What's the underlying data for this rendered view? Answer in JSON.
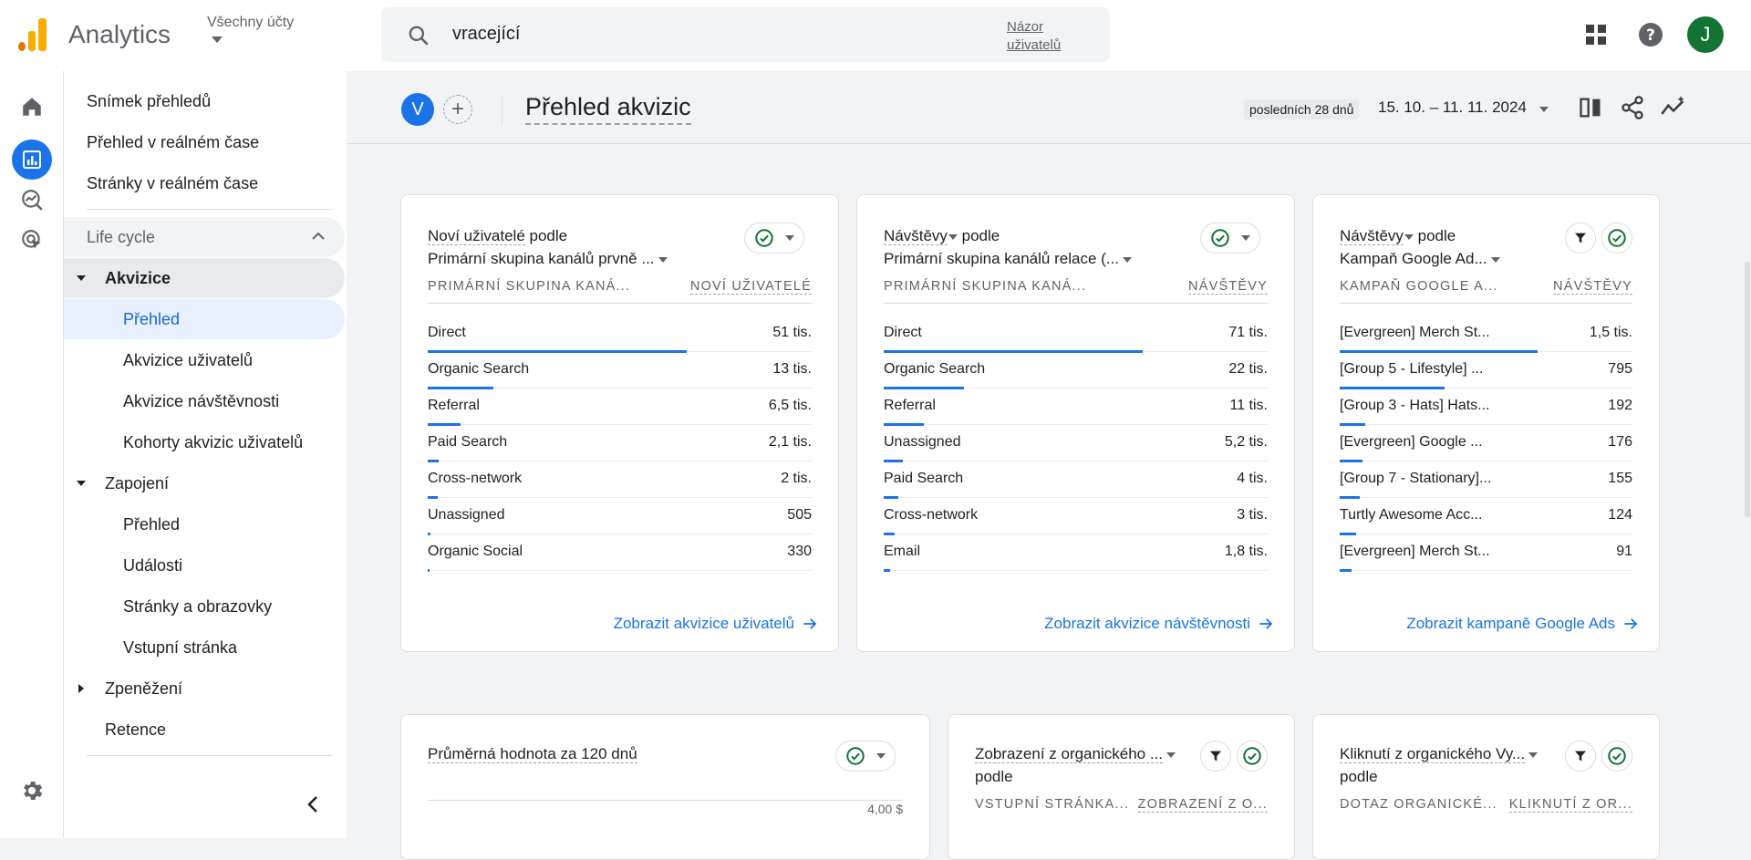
{
  "topbar": {
    "app_title": "Analytics",
    "account_label": "Všechny účty",
    "search_value": "vracející",
    "search_link": "Názor uživatelů",
    "avatar_letter": "J"
  },
  "rail": {
    "icons": [
      "home-icon",
      "reports-icon",
      "explore-icon",
      "advertising-icon",
      "settings-icon"
    ]
  },
  "sidebar": {
    "items": [
      {
        "label": "Snímek přehledů"
      },
      {
        "label": "Přehled v reálném čase"
      },
      {
        "label": "Stránky v reálném čase"
      },
      {
        "label": "Life cycle"
      },
      {
        "label": "Akvizice"
      },
      {
        "label": "Přehled"
      },
      {
        "label": "Akvizice uživatelů"
      },
      {
        "label": "Akvizice návštěvnosti"
      },
      {
        "label": "Kohorty akvizic uživatelů"
      },
      {
        "label": "Zapojení"
      },
      {
        "label": "Přehled"
      },
      {
        "label": "Události"
      },
      {
        "label": "Stránky a obrazovky"
      },
      {
        "label": "Vstupní stránka"
      },
      {
        "label": "Zpeněžení"
      },
      {
        "label": "Retence"
      }
    ]
  },
  "header": {
    "badge": "V",
    "add": "+",
    "title": "Přehled akvizic",
    "date_chip": "posledních 28 dnů",
    "date_range": "15. 10. – 11. 11. 2024"
  },
  "cards": [
    {
      "title_line1": "Noví uživatelé",
      "title_podle": " podle",
      "title_line2": "Primární skupina kanálů prvně ...",
      "col_left": "PRIMÁRNÍ SKUPINA KANÁ...",
      "col_right": "NOVÍ UŽIVATELÉ",
      "rows": [
        {
          "label": "Direct",
          "value": "51 tis.",
          "share": 1.0
        },
        {
          "label": "Organic Search",
          "value": "13 tis.",
          "share": 0.255
        },
        {
          "label": "Referral",
          "value": "6,5 tis.",
          "share": 0.127
        },
        {
          "label": "Paid Search",
          "value": "2,1 tis.",
          "share": 0.041
        },
        {
          "label": "Cross-network",
          "value": "2 tis.",
          "share": 0.039
        },
        {
          "label": "Unassigned",
          "value": "505",
          "share": 0.01
        },
        {
          "label": "Organic Social",
          "value": "330",
          "share": 0.006
        }
      ],
      "link": "Zobrazit akvizice uživatelů"
    },
    {
      "title_line1": "Návštěvy",
      "title_podle": " podle",
      "title_line2": "Primární skupina kanálů relace (...",
      "col_left": "PRIMÁRNÍ SKUPINA KANÁ...",
      "col_right": "NÁVŠTĚVY",
      "rows": [
        {
          "label": "Direct",
          "value": "71 tis.",
          "share": 1.0
        },
        {
          "label": "Organic Search",
          "value": "22 tis.",
          "share": 0.31
        },
        {
          "label": "Referral",
          "value": "11 tis.",
          "share": 0.155
        },
        {
          "label": "Unassigned",
          "value": "5,2 tis.",
          "share": 0.073
        },
        {
          "label": "Paid Search",
          "value": "4 tis.",
          "share": 0.056
        },
        {
          "label": "Cross-network",
          "value": "3 tis.",
          "share": 0.042
        },
        {
          "label": "Email",
          "value": "1,8 tis.",
          "share": 0.025
        }
      ],
      "link": "Zobrazit akvizice návštěvnosti"
    },
    {
      "title_line1": "Návštěvy",
      "title_podle": " podle",
      "title_line2": "Kampaň Google Ad...",
      "col_left": "KAMPAŇ GOOGLE A...",
      "col_right": "NÁVŠTĚVY",
      "rows": [
        {
          "label": "[Evergreen] Merch St...",
          "value": "1,5 tis.",
          "share": 1.0
        },
        {
          "label": "[Group 5 - Lifestyle] ...",
          "value": "795",
          "share": 0.53
        },
        {
          "label": "[Group 3 - Hats] Hats...",
          "value": "192",
          "share": 0.128
        },
        {
          "label": "[Evergreen] Google ...",
          "value": "176",
          "share": 0.117
        },
        {
          "label": "[Group 7 - Stationary]...",
          "value": "155",
          "share": 0.103
        },
        {
          "label": "Turtly Awesome Acc...",
          "value": "124",
          "share": 0.083
        },
        {
          "label": "[Evergreen] Merch St...",
          "value": "91",
          "share": 0.061
        }
      ],
      "link": "Zobrazit kampaně Google Ads"
    }
  ],
  "bottom_cards": [
    {
      "title": "Průměrná hodnota za 120 dnů",
      "axis_value": "4,00 $"
    },
    {
      "title_line1": "Zobrazení z organického ...",
      "title_line2": "podle",
      "col_left": "VSTUPNÍ STRÁNKA...",
      "col_right": "ZOBRAZENÍ Z O..."
    },
    {
      "title_line1": "Kliknutí z organického Vy...",
      "title_line2": "podle",
      "col_left": "DOTAZ ORGANICKÉ...",
      "col_right": "KLIKNUTÍ Z OR..."
    }
  ],
  "colors": {
    "accent": "#1a73e8",
    "success": "#137333",
    "logo_orange": "#f9ab00"
  }
}
